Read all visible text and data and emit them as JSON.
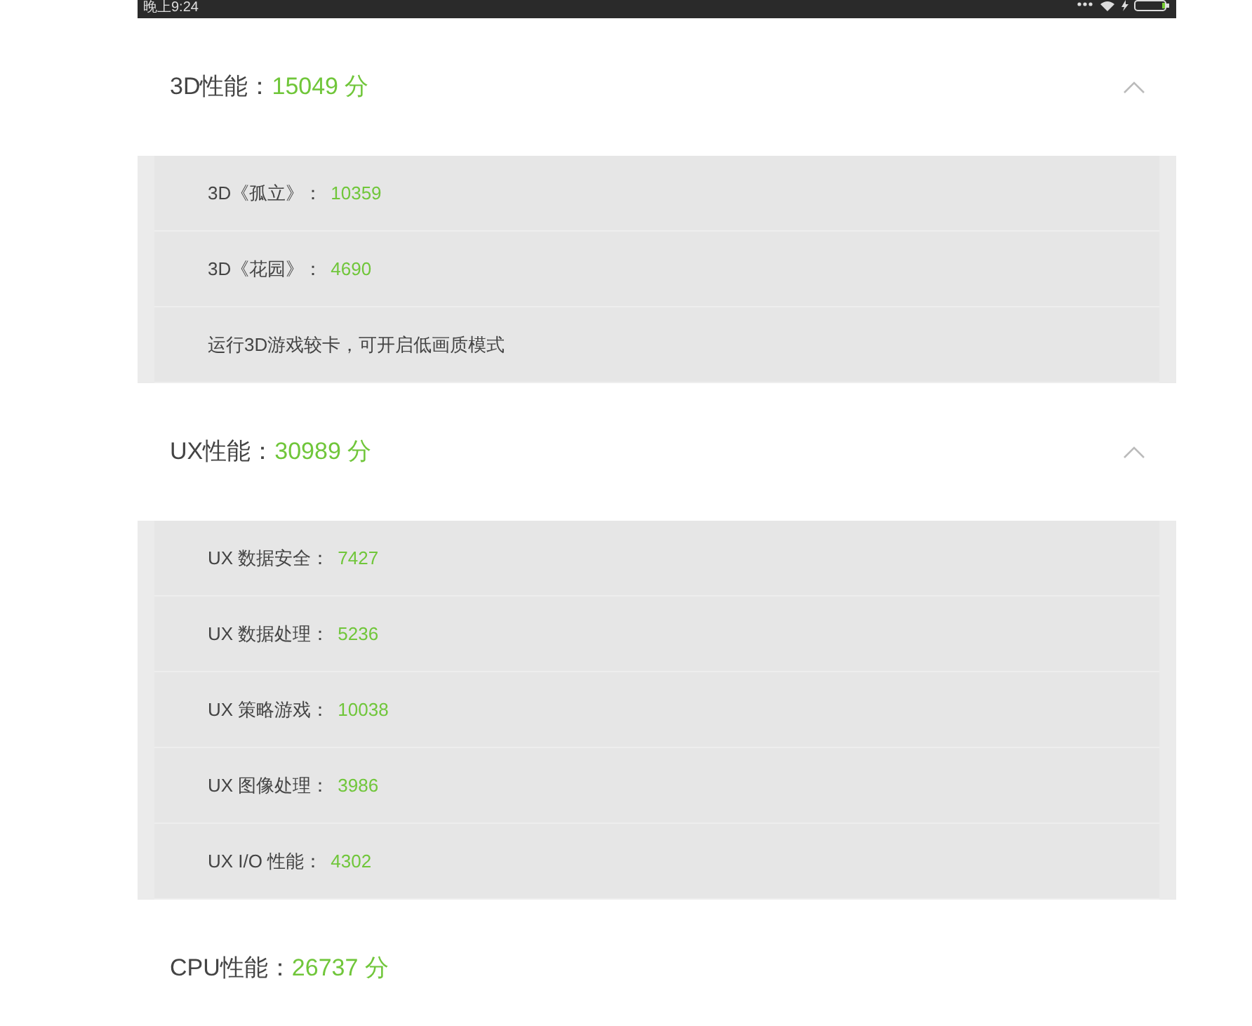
{
  "status_bar": {
    "time": "晚上9:24"
  },
  "sections": [
    {
      "label": "3D性能：",
      "score": "15049",
      "unit": "分",
      "expanded": true,
      "items": [
        {
          "kind": "score",
          "label": "3D《孤立》：",
          "value": "10359"
        },
        {
          "kind": "score",
          "label": "3D《花园》：",
          "value": "4690"
        },
        {
          "kind": "note",
          "label": "运行3D游戏较卡，可开启低画质模式"
        }
      ]
    },
    {
      "label": "UX性能：",
      "score": "30989",
      "unit": "分",
      "expanded": true,
      "items": [
        {
          "kind": "score",
          "label": "UX 数据安全：",
          "value": "7427"
        },
        {
          "kind": "score",
          "label": "UX 数据处理：",
          "value": "5236"
        },
        {
          "kind": "score",
          "label": "UX 策略游戏：",
          "value": "10038"
        },
        {
          "kind": "score",
          "label": "UX 图像处理：",
          "value": "3986"
        },
        {
          "kind": "score",
          "label": "UX I/O 性能：",
          "value": "4302"
        }
      ]
    },
    {
      "label": "CPU性能：",
      "score": "26737",
      "unit": "分"
    }
  ]
}
